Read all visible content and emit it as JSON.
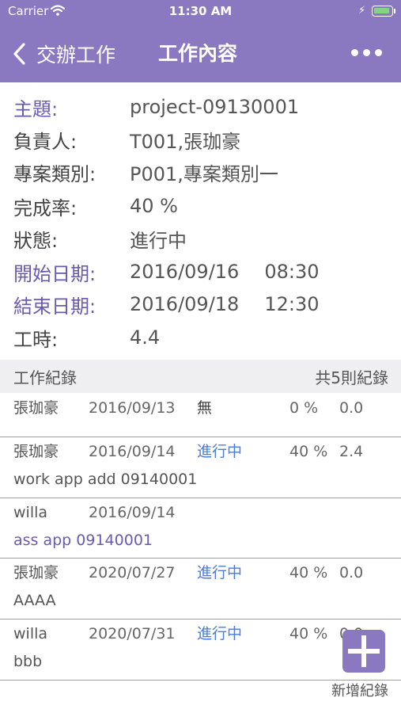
{
  "status_bar": {
    "carrier": "Carrier",
    "time": "11:30 AM"
  },
  "nav": {
    "back_label": "交辦工作",
    "title": "工作內容"
  },
  "info": {
    "subject_label": "主題:",
    "subject_value": "project-09130001",
    "owner_label": "負責人:",
    "owner_value": "T001,張珈豪",
    "category_label": "專案類別:",
    "category_value": "P001,專案類別一",
    "completion_label": "完成率:",
    "completion_value": "40 %",
    "status_label": "狀態:",
    "status_value": "進行中",
    "start_label": "開始日期:",
    "start_date": "2016/09/16",
    "start_time": "08:30",
    "end_label": "結束日期:",
    "end_date": "2016/09/18",
    "end_time": "12:30",
    "hours_label": "工時:",
    "hours_value": "4.4"
  },
  "records_header": {
    "title": "工作紀錄",
    "count": "共5則紀錄"
  },
  "records": [
    {
      "name": "張珈豪",
      "date": "2016/09/13",
      "status": "無",
      "rate": "0 %",
      "hours": "0.0",
      "desc": ""
    },
    {
      "name": "張珈豪",
      "date": "2016/09/14",
      "status": "進行中",
      "rate": "40 %",
      "hours": "2.4",
      "desc": "work app add 09140001"
    },
    {
      "name": "willa",
      "date": "2016/09/14",
      "status": "",
      "rate": "",
      "hours": "",
      "desc": "ass app 09140001"
    },
    {
      "name": "張珈豪",
      "date": "2020/07/27",
      "status": "進行中",
      "rate": "40 %",
      "hours": "0.0",
      "desc": "AAAA"
    },
    {
      "name": "willa",
      "date": "2020/07/31",
      "status": "進行中",
      "rate": "40 %",
      "hours": "0.0",
      "desc": "bbb"
    }
  ],
  "fab": {
    "label": "新增紀錄"
  },
  "colors": {
    "primary": "#8a78c0",
    "link_purple": "#6a5ab0",
    "status_blue": "#4a7cd8",
    "section_bg": "#efeff2"
  }
}
